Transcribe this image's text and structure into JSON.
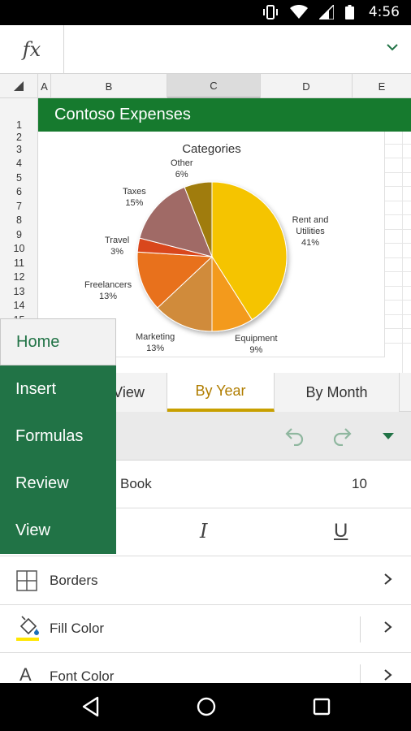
{
  "status_bar": {
    "time": "4:56"
  },
  "formula_bar": {
    "fx_label": "fx",
    "value": ""
  },
  "column_headers": [
    "A",
    "B",
    "C",
    "D",
    "E"
  ],
  "row_headers": [
    "1",
    "2",
    "3",
    "4",
    "5",
    "6",
    "7",
    "8",
    "9",
    "10",
    "11",
    "12",
    "13",
    "14",
    "15"
  ],
  "sheet": {
    "banner_title": "Contoso Expenses"
  },
  "chart_data": {
    "type": "pie",
    "title": "Categories",
    "slices": [
      {
        "label": "Rent and Utilities",
        "pct_label": "41%",
        "value": 41,
        "color": "#F5C400"
      },
      {
        "label": "Equipment",
        "pct_label": "9%",
        "value": 9,
        "color": "#F39A1C"
      },
      {
        "label": "Marketing",
        "pct_label": "13%",
        "value": 13,
        "color": "#D08B3A"
      },
      {
        "label": "Freelancers",
        "pct_label": "13%",
        "value": 13,
        "color": "#E8711A"
      },
      {
        "label": "Travel",
        "pct_label": "3%",
        "value": 3,
        "color": "#D9461F"
      },
      {
        "label": "Taxes",
        "pct_label": "15%",
        "value": 15,
        "color": "#A06B66"
      },
      {
        "label": "Other",
        "pct_label": "6%",
        "value": 6,
        "color": "#A07C0A"
      }
    ]
  },
  "sheet_tabs": [
    {
      "label": "View",
      "active": false
    },
    {
      "label": "By Year",
      "active": true
    },
    {
      "label": "By Month",
      "active": false
    }
  ],
  "ribbon_menu": {
    "items": [
      "Home",
      "Insert",
      "Formulas",
      "Review",
      "View"
    ],
    "active": "Home"
  },
  "font": {
    "name": "Book",
    "size": "10"
  },
  "format_buttons": {
    "italic": "I",
    "underline": "U"
  },
  "commands": [
    {
      "label": "Borders",
      "icon": "borders-icon"
    },
    {
      "label": "Fill Color",
      "icon": "fill-color-icon"
    },
    {
      "label": "Font Color",
      "icon": "font-color-icon"
    }
  ],
  "colors": {
    "excel_green": "#217346",
    "banner_green": "#167A2E",
    "active_tab": "#C8A000",
    "fill_swatch": "#FFE600"
  }
}
